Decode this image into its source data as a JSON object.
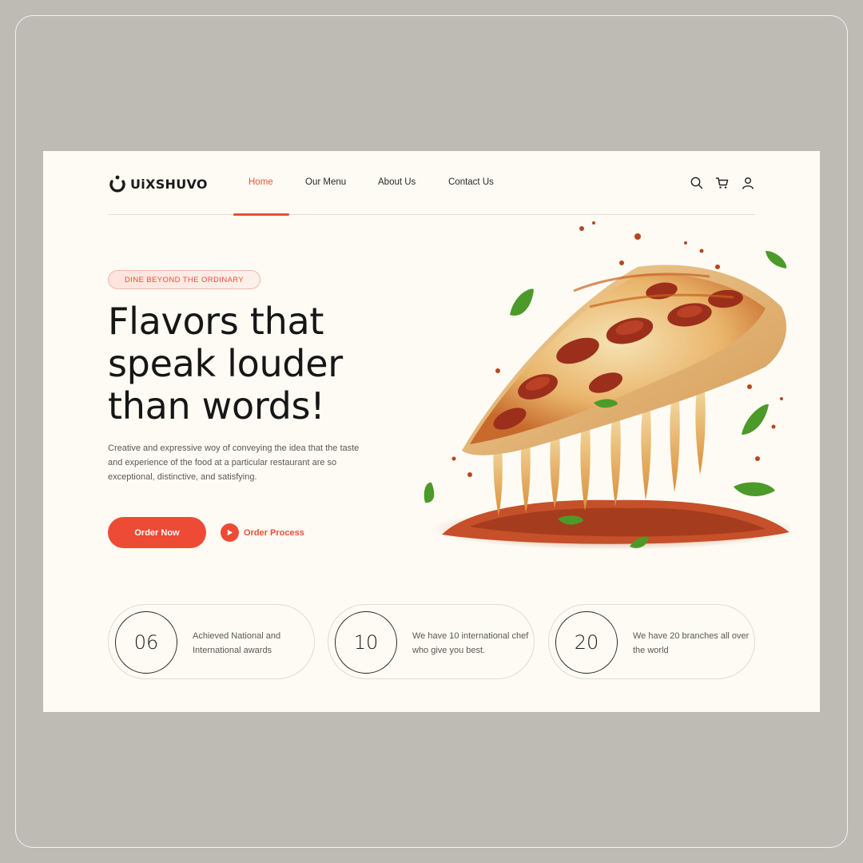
{
  "brand": {
    "name": "UiXSHUVO"
  },
  "nav": {
    "items": [
      {
        "label": "Home",
        "active": true
      },
      {
        "label": "Our Menu",
        "active": false
      },
      {
        "label": "About Us",
        "active": false
      },
      {
        "label": "Contact Us",
        "active": false
      }
    ]
  },
  "header_icons": [
    "search-icon",
    "cart-icon",
    "user-icon"
  ],
  "hero": {
    "tagline": "DINE BEYOND THE ORDINARY",
    "headline_lines": [
      "Flavors that",
      "speak louder",
      "than words!"
    ],
    "description": "Creative and expressive woy of conveying the idea that the taste and experience of the food at a particular restaurant are so exceptional, distinctive, and satisfying.",
    "primary_button": "Order Now",
    "secondary_button": "Order Process"
  },
  "stats": [
    {
      "number": "06",
      "text": "Achieved National and International awards"
    },
    {
      "number": "10",
      "text": "We have 10 international chef who give you best."
    },
    {
      "number": "20",
      "text": "We have 20 branches all over the world"
    }
  ],
  "colors": {
    "accent": "#ed4b35",
    "page_background": "#fdfbf4",
    "outer_background": "#bebbb4",
    "text_dark": "#161616"
  }
}
